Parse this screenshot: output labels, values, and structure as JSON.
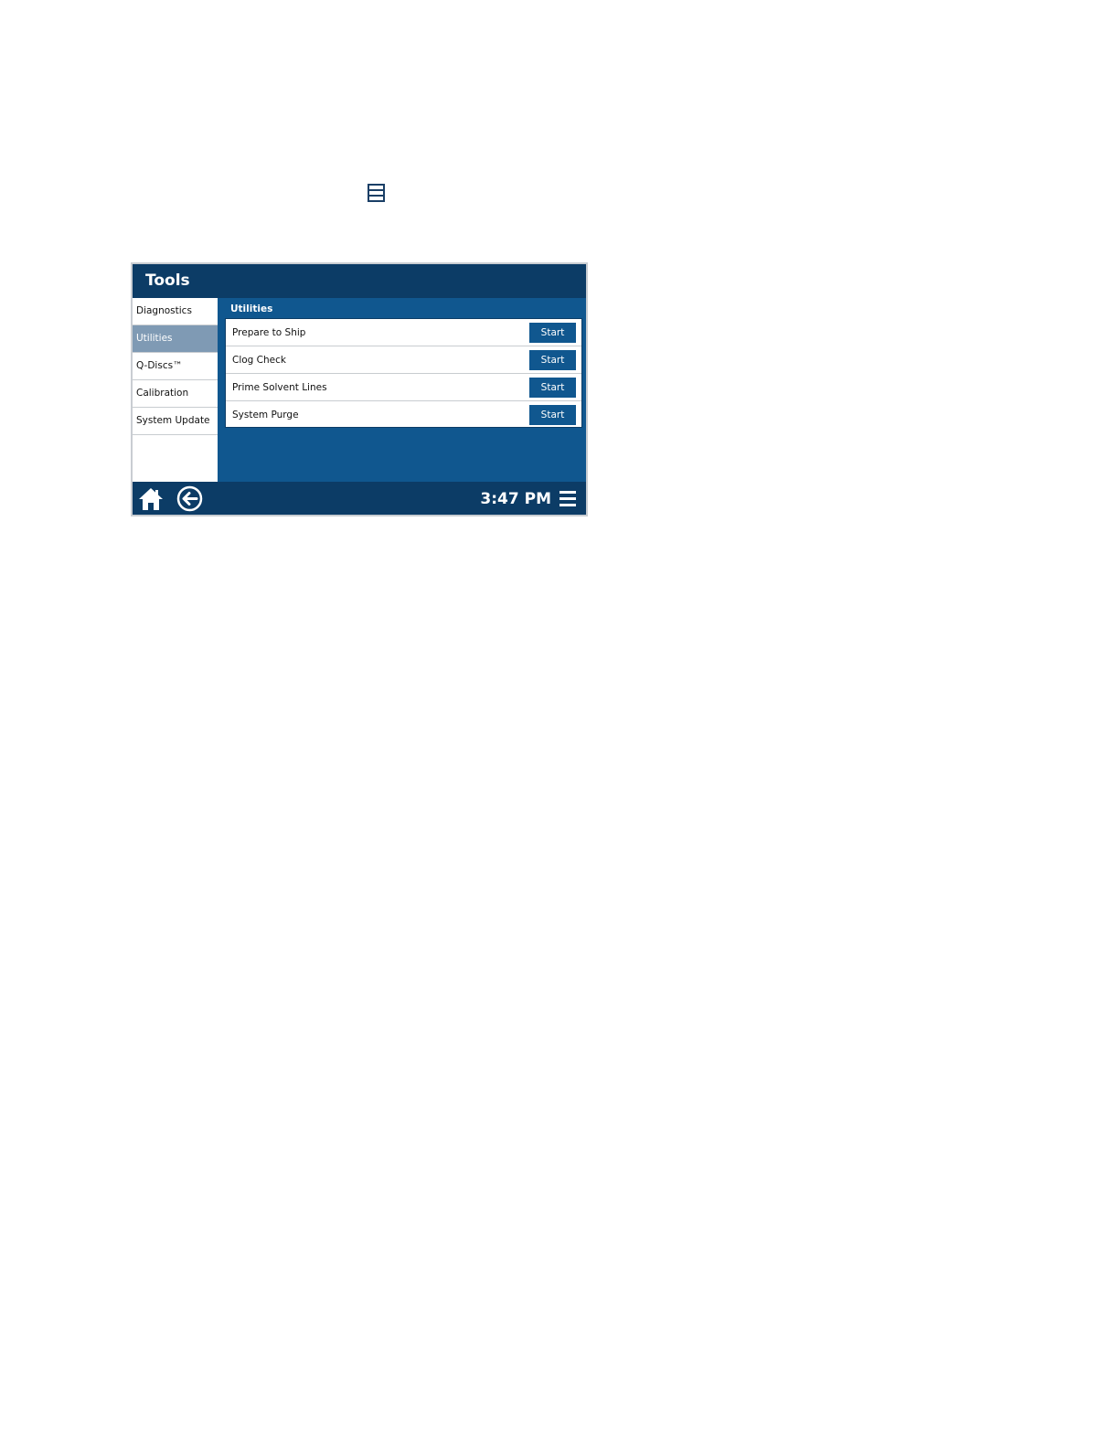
{
  "window": {
    "title": "Tools"
  },
  "sidebar": {
    "items": [
      {
        "label": "Diagnostics",
        "active": false
      },
      {
        "label": "Utilities",
        "active": true
      },
      {
        "label": "Q-Discs™",
        "active": false
      },
      {
        "label": "Calibration",
        "active": false
      },
      {
        "label": "System Update",
        "active": false
      }
    ]
  },
  "main": {
    "section_title": "Utilities",
    "utilities": [
      {
        "label": "Prepare to Ship",
        "button": "Start"
      },
      {
        "label": "Clog Check",
        "button": "Start"
      },
      {
        "label": "Prime Solvent Lines",
        "button": "Start"
      },
      {
        "label": "System Purge",
        "button": "Start"
      }
    ]
  },
  "footer": {
    "time": "3:47 PM",
    "icons": [
      "home-icon",
      "back-arrow-icon",
      "menu-icon"
    ]
  },
  "icons": {
    "standalone": "menu-icon"
  },
  "colors": {
    "header": "#0c3c66",
    "panel": "#10578f",
    "active_item": "#7f9ab4"
  }
}
